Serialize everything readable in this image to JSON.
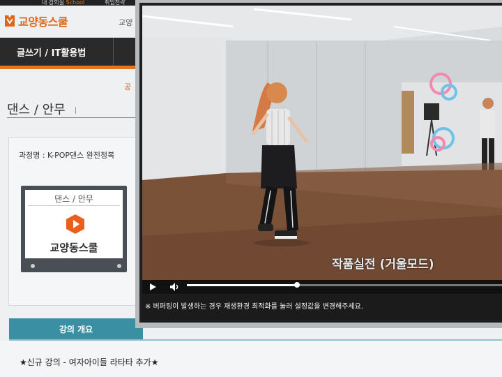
{
  "topbar": {
    "left_text": "내 강의실",
    "school_text": "School",
    "right_text": "취업전략"
  },
  "brand": {
    "name": "교양동스쿨"
  },
  "nav": {
    "active_item": "글쓰기 / IT활용법",
    "right_partial": "교양"
  },
  "sidebar_orange_text": "공",
  "section": {
    "title": "댄스 / 안무"
  },
  "course": {
    "name": "과정명 : K-POP댄스 완전정복",
    "thumb_category": "댄스 / 안무",
    "thumb_brand": "교양동스쿨"
  },
  "overview": {
    "tab_label": "강의 개요"
  },
  "notice": {
    "text": "★신규 강의 - 여자아이들 라타타 추가★"
  },
  "player": {
    "caption": "작품실전 (거울모드)",
    "progress": 0.35,
    "buffer_note": "※ 버퍼링이 발생하는 경우 재생환경 최적화를 눌러 설정값을 변경해주세요."
  },
  "icons": {
    "play": "play-icon",
    "volume": "volume-icon",
    "logo": "logo-icon",
    "thumb_play": "play-hexagon-icon"
  },
  "colors": {
    "accent": "#e8731e",
    "tab_teal": "#3a8fa2",
    "nav_dark": "#2a2a2a"
  }
}
